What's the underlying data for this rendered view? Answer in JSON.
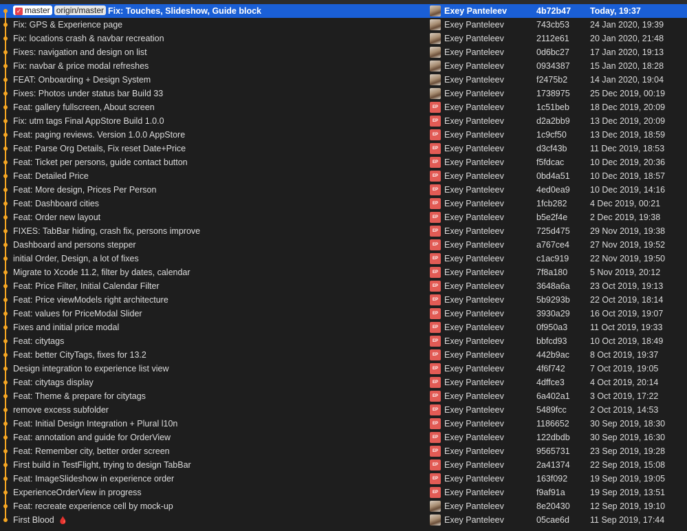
{
  "refs": {
    "local_branch": "master",
    "remote_branch": "origin/master"
  },
  "commits": [
    {
      "subject": "Fix: Touches, Slideshow, Guide block",
      "author": "Exey Panteleev",
      "sha": "4b72b47",
      "date": "Today, 19:37",
      "avatar": "photo",
      "selected": true
    },
    {
      "subject": "Fix: GPS & Experience page",
      "author": "Exey Panteleev",
      "sha": "743cb53",
      "date": "24 Jan 2020, 19:39",
      "avatar": "photo"
    },
    {
      "subject": "Fix: locations crash & navbar recreation",
      "author": "Exey Panteleev",
      "sha": "2112e61",
      "date": "20 Jan 2020, 21:48",
      "avatar": "photo"
    },
    {
      "subject": "Fixes: navigation and design on list",
      "author": "Exey Panteleev",
      "sha": "0d6bc27",
      "date": "17 Jan 2020, 19:13",
      "avatar": "photo"
    },
    {
      "subject": "Fix: navbar & price modal refreshes",
      "author": "Exey Panteleev",
      "sha": "0934387",
      "date": "15 Jan 2020, 18:28",
      "avatar": "photo"
    },
    {
      "subject": "FEAT: Onboarding + Design System",
      "author": "Exey Panteleev",
      "sha": "f2475b2",
      "date": "14 Jan 2020, 19:04",
      "avatar": "photo"
    },
    {
      "subject": "Fixes: Photos under status bar Build 33",
      "author": "Exey Panteleev",
      "sha": "1738975",
      "date": "25 Dec 2019, 00:19",
      "avatar": "photo"
    },
    {
      "subject": "Feat: gallery fullscreen, About screen",
      "author": "Exey Panteleev",
      "sha": "1c51beb",
      "date": "18 Dec 2019, 20:09",
      "avatar": "initials"
    },
    {
      "subject": "Fix: utm tags Final AppStore Build 1.0.0",
      "author": "Exey Panteleev",
      "sha": "d2a2bb9",
      "date": "13 Dec 2019, 20:09",
      "avatar": "initials"
    },
    {
      "subject": "Feat: paging reviews. Version 1.0.0 AppStore",
      "author": "Exey Panteleev",
      "sha": "1c9cf50",
      "date": "13 Dec 2019, 18:59",
      "avatar": "initials"
    },
    {
      "subject": "Feat: Parse Org Details, Fix reset Date+Price",
      "author": "Exey Panteleev",
      "sha": "d3cf43b",
      "date": "11 Dec 2019, 18:53",
      "avatar": "initials"
    },
    {
      "subject": "Feat: Ticket per persons, guide contact button",
      "author": "Exey Panteleev",
      "sha": "f5fdcac",
      "date": "10 Dec 2019, 20:36",
      "avatar": "initials"
    },
    {
      "subject": "Feat: Detailed Price",
      "author": "Exey Panteleev",
      "sha": "0bd4a51",
      "date": "10 Dec 2019, 18:57",
      "avatar": "initials"
    },
    {
      "subject": "Feat: More design, Prices Per Person",
      "author": "Exey Panteleev",
      "sha": "4ed0ea9",
      "date": "10 Dec 2019, 14:16",
      "avatar": "initials"
    },
    {
      "subject": "Feat: Dashboard cities",
      "author": "Exey Panteleev",
      "sha": "1fcb282",
      "date": "4 Dec 2019, 00:21",
      "avatar": "initials"
    },
    {
      "subject": "Feat: Order new layout",
      "author": "Exey Panteleev",
      "sha": "b5e2f4e",
      "date": "2 Dec 2019, 19:38",
      "avatar": "initials"
    },
    {
      "subject": "FIXES: TabBar hiding, crash fix, persons improve",
      "author": "Exey Panteleev",
      "sha": "725d475",
      "date": "29 Nov 2019, 19:38",
      "avatar": "initials"
    },
    {
      "subject": "Dashboard and persons stepper",
      "author": "Exey Panteleev",
      "sha": "a767ce4",
      "date": "27 Nov 2019, 19:52",
      "avatar": "initials"
    },
    {
      "subject": "initial Order, Design, a lot of fixes",
      "author": "Exey Panteleev",
      "sha": "c1ac919",
      "date": "22 Nov 2019, 19:50",
      "avatar": "initials"
    },
    {
      "subject": "Migrate to Xcode 11.2, filter by dates, calendar",
      "author": "Exey Panteleev",
      "sha": "7f8a180",
      "date": "5 Nov 2019, 20:12",
      "avatar": "initials"
    },
    {
      "subject": "Feat: Price Filter, Initial Calendar Filter",
      "author": "Exey Panteleev",
      "sha": "3648a6a",
      "date": "23 Oct 2019, 19:13",
      "avatar": "initials"
    },
    {
      "subject": "Feat: Price viewModels right architecture",
      "author": "Exey Panteleev",
      "sha": "5b9293b",
      "date": "22 Oct 2019, 18:14",
      "avatar": "initials"
    },
    {
      "subject": "Feat: values for PriceModal Slider",
      "author": "Exey Panteleev",
      "sha": "3930a29",
      "date": "16 Oct 2019, 19:07",
      "avatar": "initials"
    },
    {
      "subject": "Fixes and initial price modal",
      "author": "Exey Panteleev",
      "sha": "0f950a3",
      "date": "11 Oct 2019, 19:33",
      "avatar": "initials"
    },
    {
      "subject": "Feat: citytags",
      "author": "Exey Panteleev",
      "sha": "bbfcd93",
      "date": "10 Oct 2019, 18:49",
      "avatar": "initials"
    },
    {
      "subject": "Feat: better CityTags, fixes for 13.2",
      "author": "Exey Panteleev",
      "sha": "442b9ac",
      "date": "8 Oct 2019, 19:37",
      "avatar": "initials"
    },
    {
      "subject": "Design integration to experience list view",
      "author": "Exey Panteleev",
      "sha": "4f6f742",
      "date": "7 Oct 2019, 19:05",
      "avatar": "initials"
    },
    {
      "subject": "Feat: citytags display",
      "author": "Exey Panteleev",
      "sha": "4dffce3",
      "date": "4 Oct 2019, 20:14",
      "avatar": "initials"
    },
    {
      "subject": "Feat: Theme & prepare for citytags",
      "author": "Exey Panteleev",
      "sha": "6a402a1",
      "date": "3 Oct 2019, 17:22",
      "avatar": "initials"
    },
    {
      "subject": "remove excess subfolder",
      "author": "Exey Panteleev",
      "sha": "5489fcc",
      "date": "2 Oct 2019, 14:53",
      "avatar": "initials"
    },
    {
      "subject": "Feat: Initial Design Integration + Plural l10n",
      "author": "Exey Panteleev",
      "sha": "1186652",
      "date": "30 Sep 2019, 18:30",
      "avatar": "initials"
    },
    {
      "subject": "Feat: annotation and guide for OrderView",
      "author": "Exey Panteleev",
      "sha": "122dbdb",
      "date": "30 Sep 2019, 16:30",
      "avatar": "initials"
    },
    {
      "subject": "Feat: Remember city, better order screen",
      "author": "Exey Panteleev",
      "sha": "9565731",
      "date": "23 Sep 2019, 19:28",
      "avatar": "initials"
    },
    {
      "subject": "First build in TestFlight, trying to design TabBar",
      "author": "Exey Panteleev",
      "sha": "2a41374",
      "date": "22 Sep 2019, 15:08",
      "avatar": "initials"
    },
    {
      "subject": "Feat: ImageSlideshow in experience order",
      "author": "Exey Panteleev",
      "sha": "163f092",
      "date": "19 Sep 2019, 19:05",
      "avatar": "initials"
    },
    {
      "subject": "ExperienceOrderView in progress",
      "author": "Exey Panteleev",
      "sha": "f9af91a",
      "date": "19 Sep 2019, 13:51",
      "avatar": "initials"
    },
    {
      "subject": "Feat: recreate experience cell by mock-up",
      "author": "Exey Panteleev",
      "sha": "8e20430",
      "date": "12 Sep 2019, 19:10",
      "avatar": "photo"
    },
    {
      "subject": "First Blood",
      "author": "Exey Panteleev",
      "sha": "05cae6d",
      "date": "11 Sep 2019, 17:44",
      "avatar": "photo",
      "emoji": "🩸"
    }
  ],
  "avatar_initials": "EP",
  "colors": {
    "background": "#1e1e1e",
    "selection": "#1a5fd6",
    "graph": "#f5a623",
    "initials_avatar": "#e25b55"
  }
}
